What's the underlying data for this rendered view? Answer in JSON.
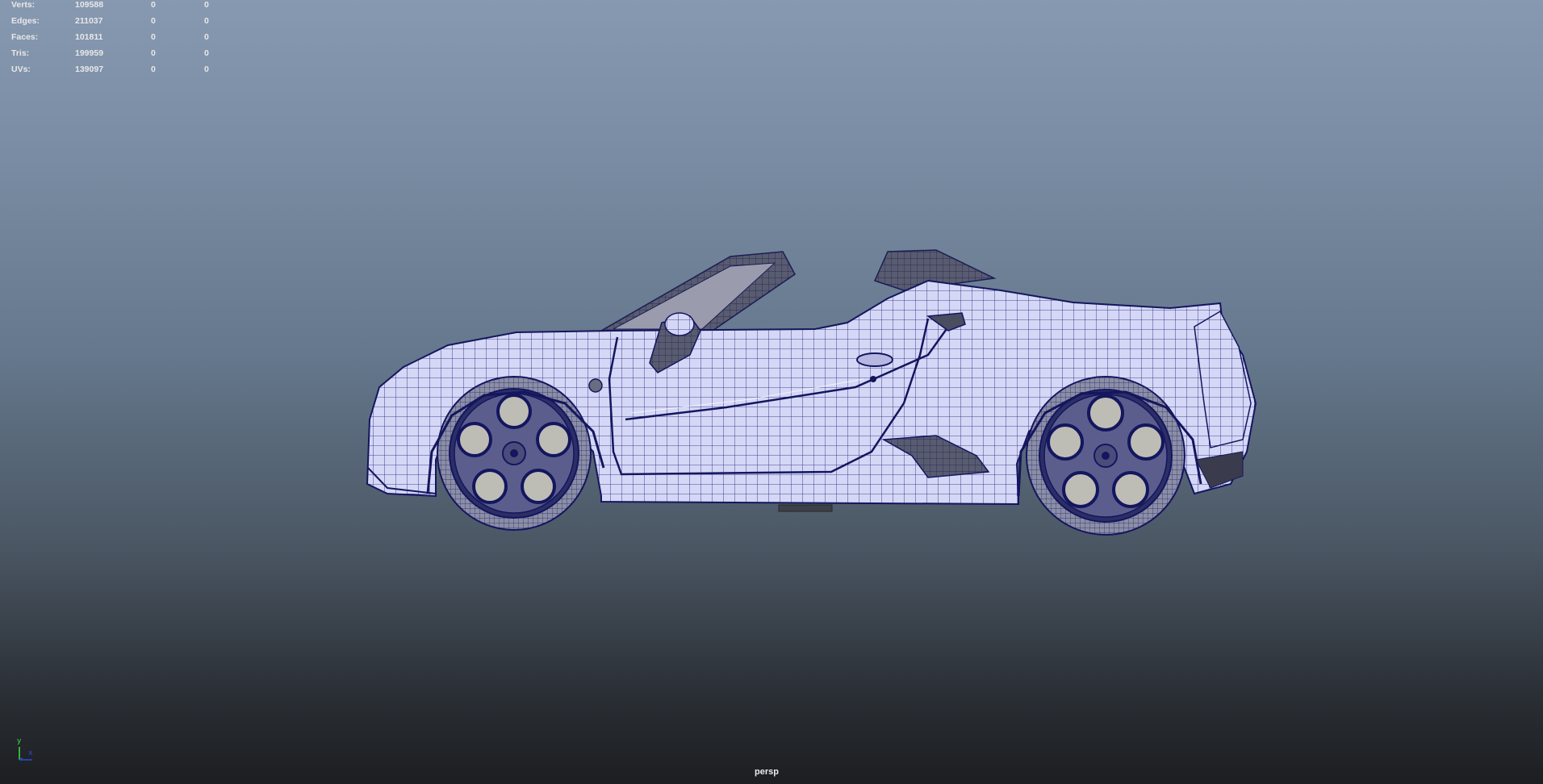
{
  "viewport": {
    "camera_name": "persp",
    "background_top": "#8799b1",
    "background_bottom": "#1c1e21"
  },
  "hud_stats": [
    {
      "label": "Verts:",
      "total": "109588",
      "selected": "0",
      "third": "0"
    },
    {
      "label": "Edges:",
      "total": "211037",
      "selected": "0",
      "third": "0"
    },
    {
      "label": "Faces:",
      "total": "101811",
      "selected": "0",
      "third": "0"
    },
    {
      "label": "Tris:",
      "total": "199959",
      "selected": "0",
      "third": "0"
    },
    {
      "label": "UVs:",
      "total": "139097",
      "selected": "0",
      "third": "0"
    }
  ],
  "axis_gizmo": {
    "y_label": "y",
    "x_label": "x",
    "y_color": "#3fe03f",
    "x_color": "#2c4ad8",
    "z_color": "#2c4ad8"
  },
  "model": {
    "description_icon": "car-wireframe-model",
    "shade_color": "#d4d6f6",
    "wire_color": "#16186e",
    "dark_color": "#4c4f60"
  }
}
